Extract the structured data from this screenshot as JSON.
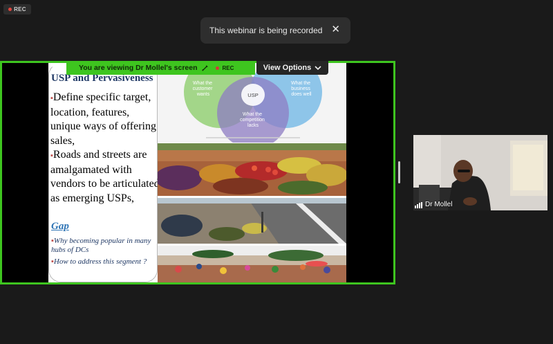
{
  "top_badge": {
    "label": "REC"
  },
  "notification": {
    "text": "This webinar is being recorded",
    "close_glyph": "✕"
  },
  "share_bar": {
    "viewing_text": "You are viewing  Dr Mollel's screen",
    "rec_label": "REC",
    "view_options_label": "View Options",
    "chevron_glyph": "❯"
  },
  "slide": {
    "title": "USP and Pervasiveness",
    "bullets": [
      "Define specific target, location, features, unique ways of offering sales,",
      "Roads and streets are amalgamated  with vendors to be articulated as emerging USPs,"
    ],
    "bullet_glyph": "▪",
    "gap_heading": "Gap",
    "gap_bullets": [
      "Why becoming popular in many hubs of DCs",
      "How to address this segment ?"
    ],
    "venn": {
      "left_circle": "What the customer wants",
      "right_circle": "What the business does well",
      "bottom_circle": "What the competition lacks",
      "center": "USP"
    }
  },
  "participant": {
    "name": "Dr Mollel"
  },
  "colors": {
    "share_green": "#3ec51f",
    "background": "#1a1a1a",
    "rec_red": "#e0463f"
  }
}
